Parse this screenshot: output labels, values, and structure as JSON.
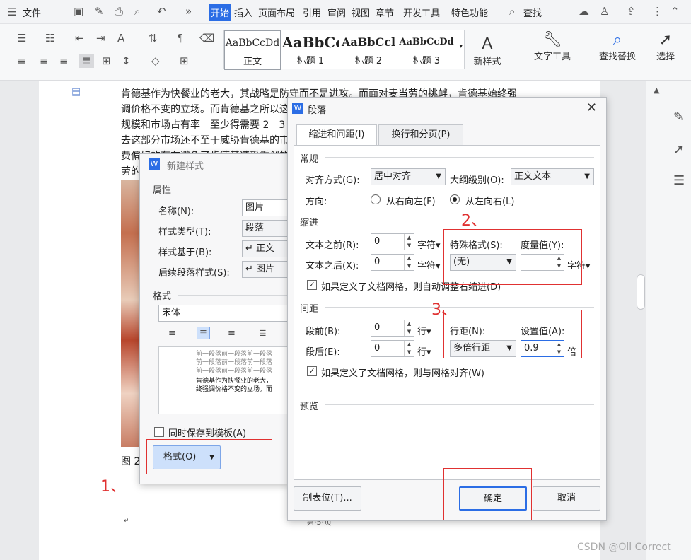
{
  "menubar": {
    "file": "文件",
    "tabs": [
      "开始",
      "插入",
      "页面布局",
      "引用",
      "审阅",
      "视图",
      "章节",
      "开发工具",
      "特色功能"
    ],
    "search": "查找"
  },
  "ribbon": {
    "styles": [
      {
        "sample": "AaBbCcDd",
        "label": "正文"
      },
      {
        "sample": "AaBbCc",
        "label": "标题 1"
      },
      {
        "sample": "AaBbCcl",
        "label": "标题 2"
      },
      {
        "sample": "AaBbCcDd",
        "label": "标题 3"
      }
    ],
    "new_style": "新样式",
    "text_tool": "文字工具",
    "find_replace": "查找替换",
    "select": "选择"
  },
  "document": {
    "lines": [
      "肯德基作为快餐业的老大，其战略是防守而不是进攻。而面对麦当劳的挑衅，肯德基始终强",
      "调价格不变的立场。而肯德基之所以这",
      "规模和市场占有率　至少得需要 2－3 年",
      "去这部分市场还不至于威胁肯德基的市",
      "费偏好的存在避免了肯德基遭受重创的",
      "劳的挑"
    ],
    "caption": "图 2-价",
    "page": "第·5·页"
  },
  "new_style_dialog": {
    "title": "新建样式",
    "section_props": "属性",
    "name_label": "名称(N):",
    "name_value": "图片",
    "type_label": "样式类型(T):",
    "type_value": "段落",
    "based_label": "样式基于(B):",
    "based_value": "↵ 正文",
    "next_label": "后续段落样式(S):",
    "next_value": "↵ 图片",
    "section_format": "格式",
    "font_value": "宋体",
    "preview_prev": [
      "前一段落前一段落前一段落",
      "前一段落前一段落前一段落",
      "前一段落前一段落前一段落"
    ],
    "preview_text": [
      "肯德基作为快餐业的老大，",
      "终强调价格不变的立场。而"
    ],
    "save_template": "同时保存到模板(A)",
    "format_button": "格式(O)"
  },
  "paragraph_dialog": {
    "title": "段落",
    "tabs": [
      "缩进和间距(I)",
      "换行和分页(P)"
    ],
    "general": "常规",
    "align_label": "对齐方式(G):",
    "align_value": "居中对齐",
    "outline_label": "大纲级别(O):",
    "outline_value": "正文文本",
    "direction_label": "方向:",
    "rtl": "从右向左(F)",
    "ltr": "从左向右(L)",
    "indent": "缩进",
    "before_text_label": "文本之前(R):",
    "before_text_value": "0",
    "after_text_label": "文本之后(X):",
    "after_text_value": "0",
    "unit_char": "字符▾",
    "special_label": "特殊格式(S):",
    "special_value": "(无)",
    "measure_label": "度量值(Y):",
    "measure_value": "",
    "grid_indent": "如果定义了文档网格，则自动调整右缩进(D)",
    "spacing": "间距",
    "before_label": "段前(B):",
    "before_value": "0",
    "after_label": "段后(E):",
    "after_value": "0",
    "unit_line": "行▾",
    "line_spacing_label": "行距(N):",
    "line_spacing_value": "多倍行距",
    "set_value_label": "设置值(A):",
    "set_value": "0.9",
    "unit_times": "倍",
    "grid_align": "如果定义了文档网格，则与网格对齐(W)",
    "preview": "预览",
    "tabs_button": "制表位(T)...",
    "ok": "确定",
    "cancel": "取消"
  },
  "annotations": {
    "a1": "1、",
    "a2": "2、",
    "a3": "3、"
  },
  "watermark": "CSDN @Oll Correct"
}
